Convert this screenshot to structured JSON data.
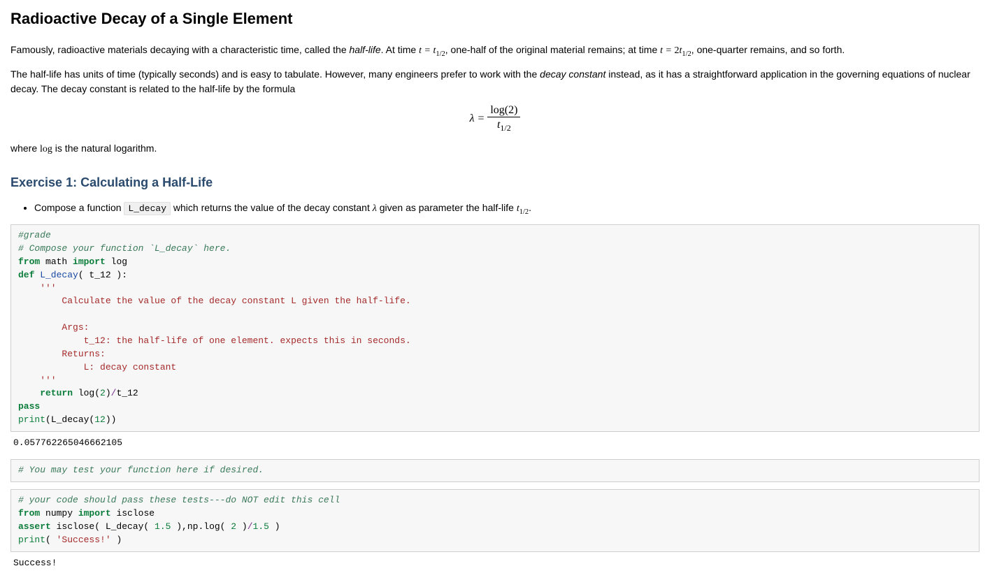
{
  "heading": "Radioactive Decay of a Single Element",
  "para1": {
    "a": "Famously, radioactive materials decaying with a characteristic time, called the ",
    "halflife": "half-life",
    "b": ". At time ",
    "eq1_pre": "t = t",
    "eq1_sub": "1/2",
    "c": ", one-half of the original material remains; at time ",
    "eq2_pre": "t = ",
    "eq2_two": "2",
    "eq2_t": "t",
    "eq2_sub": "1/2",
    "d": ", one-quarter remains, and so forth."
  },
  "para2": {
    "a": "The half-life has units of time (typically seconds) and is easy to tabulate. However, many engineers prefer to work with the ",
    "dc": "decay constant",
    "b": " instead, as it has a straightforward application in the governing equations of nuclear decay. The decay constant is related to the half-life by the formula"
  },
  "formula": {
    "lhs": "λ = ",
    "num_log": "log",
    "num_paren": "(2)",
    "den_t": "t",
    "den_sub": "1/2"
  },
  "para3": {
    "a": "where ",
    "log": "log",
    "b": " is the natural logarithm."
  },
  "exercise": {
    "title": "Exercise 1: Calculating a Half-Life",
    "bullet": {
      "a": "Compose a function ",
      "code": "L_decay",
      "b": " which returns the value of the decay constant ",
      "lam": "λ",
      "c": " given as parameter the half-life ",
      "t": "t",
      "tsub": "1/2",
      "d": "."
    }
  },
  "cell1": {
    "l1": "#grade",
    "l2": "# Compose your function `L_decay` here.",
    "l3_from": "from",
    "l3_mod": " math ",
    "l3_import": "import",
    "l3_name": " log",
    "l4_def": "def",
    "l4_name": " L_decay",
    "l4_paren": "( t_12 ):",
    "l5": "    '''",
    "l6": "        Calculate the value of the decay constant L given the half-life.",
    "l7": "",
    "l8": "        Args:",
    "l9": "            t_12: the half-life of one element. expects this in seconds.",
    "l10": "        Returns:",
    "l11": "            L: decay constant",
    "l12": "    '''",
    "l13_ret": "    return",
    "l13_sp": " log(",
    "l13_num": "2",
    "l13_close": ")",
    "l13_op": "/",
    "l13_var": "t_12",
    "l14": "pass",
    "l15_print": "print",
    "l15_open": "(L_decay(",
    "l15_num": "12",
    "l15_close": "))"
  },
  "out1": "0.057762265046662105",
  "cell2": {
    "l1": "# You may test your function here if desired."
  },
  "cell3": {
    "l1": "# your code should pass these tests---do NOT edit this cell",
    "l2_from": "from",
    "l2_mod": " numpy ",
    "l2_import": "import",
    "l2_name": " isclose",
    "l3_assert": "assert",
    "l3_a": " isclose( L_decay( ",
    "l3_n1": "1.5",
    "l3_b": " ),np.",
    "l3_log": "log",
    "l3_c": "( ",
    "l3_n2": "2",
    "l3_d": " )",
    "l3_op": "/",
    "l3_n3": "1.5",
    "l3_e": " )",
    "l4_print": "print",
    "l4_a": "( ",
    "l4_s": "'Success!'",
    "l4_b": " )"
  },
  "out2": "Success!"
}
